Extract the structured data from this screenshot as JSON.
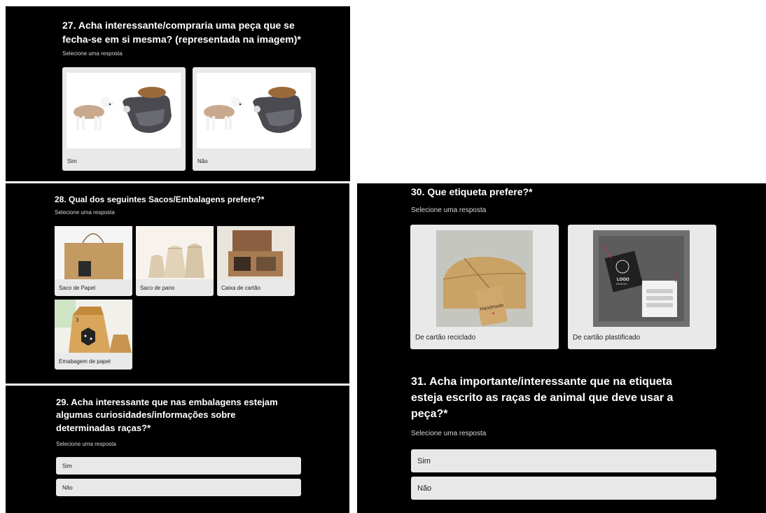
{
  "q27": {
    "title_line1": "27. Acha interessante/compraria uma peça que se",
    "title_line2": "fecha-se em si mesma? (representada na imagem)*",
    "hint": "Selecione uma resposta",
    "options": [
      "Sim",
      "Não"
    ]
  },
  "q28": {
    "title": "28. Qual dos seguintes Sacos/Embalagens prefere?*",
    "hint": "Selecione uma resposta",
    "options": [
      "Saco de Papel",
      "Saco de pano",
      "Caixa de cartão",
      "Emabagem de papel"
    ]
  },
  "q29": {
    "title_line1": "29. Acha interessante que nas embalagens estejam",
    "title_line2": "algumas curiosidades/informações sobre",
    "title_line3": "determinadas raças?*",
    "hint": "Selecione uma resposta",
    "options": [
      "Sim",
      "Não"
    ]
  },
  "q30": {
    "title": "30. Que etiqueta prefere?*",
    "hint": "Selecione uma resposta",
    "options": [
      "De cartão reciclado",
      "De cartão plastificado"
    ],
    "img_text": {
      "tag": "Handmade",
      "logo_line1": "LOGO",
      "logo_line2": "DESIGN"
    }
  },
  "q31": {
    "title_line1": "31. Acha importante/interessante que na etiqueta",
    "title_line2": "esteja escrito as raças de animal que deve usar a",
    "title_line3": "peça?*",
    "hint": "Selecione uma resposta",
    "options": [
      "Sim",
      "Não"
    ]
  },
  "q28_img_text": {
    "box_label": "3"
  }
}
